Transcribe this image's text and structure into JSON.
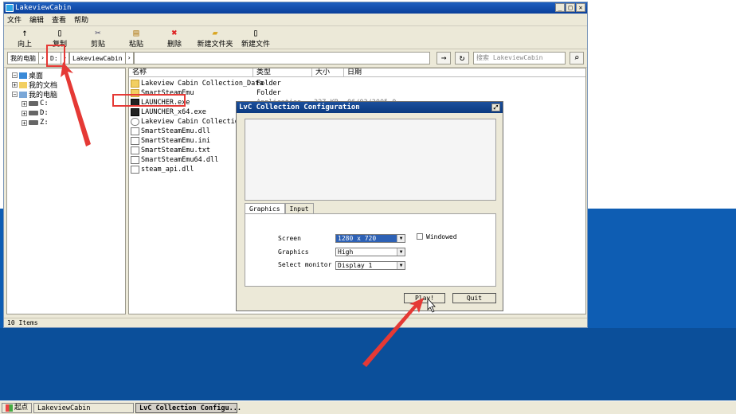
{
  "explorer": {
    "title": "LakeviewCabin",
    "menu": [
      "文件",
      "编辑",
      "查看",
      "帮助"
    ],
    "toolbar": [
      {
        "label": "向上",
        "icon": "up-arrow-icon",
        "glyph": "🡑"
      },
      {
        "label": "复制",
        "icon": "copy-icon",
        "glyph": "⎘"
      },
      {
        "label": "剪贴",
        "icon": "cut-icon",
        "glyph": "✂"
      },
      {
        "label": "粘贴",
        "icon": "paste-icon",
        "glyph": "📋"
      },
      {
        "label": "删除",
        "icon": "delete-icon",
        "glyph": "✖"
      },
      {
        "label": "新建文件夹",
        "icon": "new-folder-icon",
        "glyph": "📁"
      },
      {
        "label": "新建文件",
        "icon": "new-file-icon",
        "glyph": "📄"
      }
    ],
    "address": {
      "root": "我的电脑",
      "drive": "D:",
      "folder": "LakeviewCabin"
    },
    "search_placeholder": "搜索 LakeviewCabin",
    "tree": {
      "desktop": "桌面",
      "documents": "我的文档",
      "computer": "我的电脑",
      "drives": [
        "C:",
        "D:",
        "Z:"
      ]
    },
    "columns": {
      "name": "名称",
      "type": "类型",
      "size": "大小",
      "date": "日期"
    },
    "files": [
      {
        "name": "Lakeview Cabin Collection_Data",
        "type": "Folder",
        "icon": "folder"
      },
      {
        "name": "SmartSteamEmu",
        "type": "Folder",
        "icon": "folder"
      },
      {
        "name": "LAUNCHER.exe",
        "type": "Application",
        "size": "327 KB",
        "date": "06/03/2005 0",
        "icon": "exe"
      },
      {
        "name": "LAUNCHER_x64.exe",
        "type": "",
        "icon": "exe"
      },
      {
        "name": "Lakeview Cabin Collection.exe",
        "type": "",
        "icon": "exe"
      },
      {
        "name": "SmartSteamEmu.dll",
        "type": "",
        "icon": "doc"
      },
      {
        "name": "SmartSteamEmu.ini",
        "type": "",
        "icon": "doc"
      },
      {
        "name": "SmartSteamEmu.txt",
        "type": "",
        "icon": "doc"
      },
      {
        "name": "SmartSteamEmu64.dll",
        "type": "",
        "icon": "doc"
      },
      {
        "name": "steam_api.dll",
        "type": "",
        "icon": "doc"
      }
    ],
    "status": "10 Items"
  },
  "dialog": {
    "title": "LvC Collection Configuration",
    "tabs": [
      "Graphics",
      "Input"
    ],
    "screen_label": "Screen",
    "screen_value": "1280 x 720",
    "windowed_label": "Windowed",
    "graphics_label": "Graphics",
    "graphics_value": "High",
    "monitor_label": "Select monitor",
    "monitor_value": "Display 1",
    "play_label": "Play!",
    "quit_label": "Quit"
  },
  "taskbar": {
    "start": "起点",
    "items": [
      "LakeviewCabin",
      "LvC Collection Configu..."
    ]
  },
  "colors": {
    "annotation": "#e53935",
    "titlebar": "#1d5fbf",
    "desktop": "#0e5db3"
  }
}
